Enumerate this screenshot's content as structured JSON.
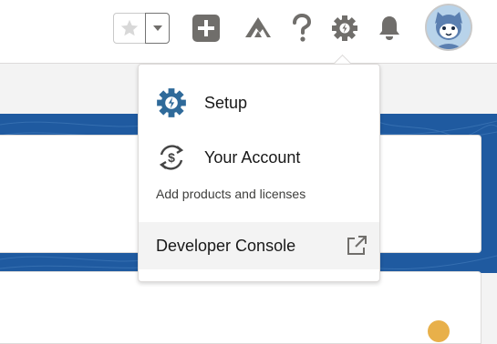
{
  "header": {
    "icons": {
      "favorite": "star-icon",
      "favorites_menu": "chevron-down-icon",
      "global_actions": "add-icon",
      "trailhead": "trailhead-icon",
      "help": "question-icon",
      "setup": "gear-icon",
      "notifications": "bell-icon",
      "avatar": "user-avatar"
    }
  },
  "setup_menu": {
    "items": [
      {
        "label": "Setup",
        "icon": "setup-gear-icon"
      },
      {
        "label": "Your Account",
        "icon": "account-dollar-icon"
      }
    ],
    "account_sublink": "Add products and licenses",
    "footer": {
      "label": "Developer Console",
      "icon": "external-link-icon"
    }
  },
  "colors": {
    "brand_blue": "#1f5aa0",
    "icon_gray": "#706e6b",
    "setup_icon": "#2f6a9a"
  }
}
